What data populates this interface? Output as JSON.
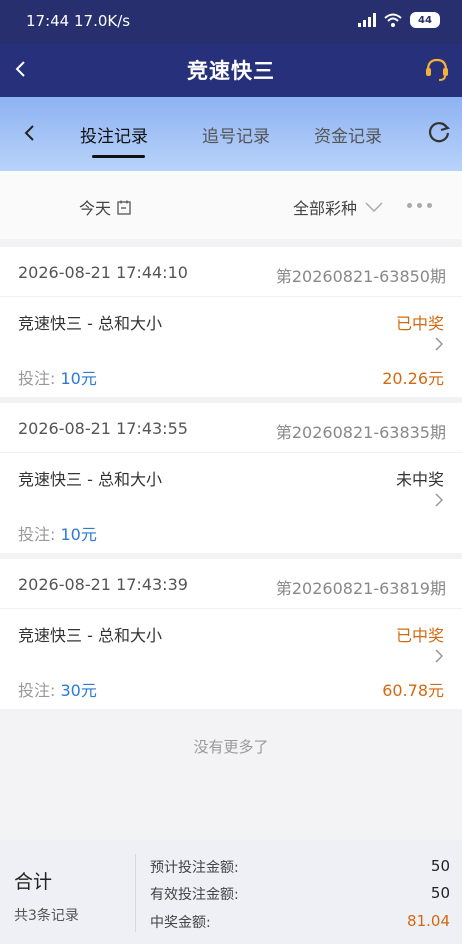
{
  "status_bar": {
    "time_speed": "17:44 17.0K/s",
    "battery": "44"
  },
  "app_bar": {
    "title": "竞速快三"
  },
  "tabs": [
    {
      "label": "投注记录",
      "active": true
    },
    {
      "label": "追号记录",
      "active": false
    },
    {
      "label": "资金记录",
      "active": false
    }
  ],
  "filters": {
    "date": "今天",
    "lottery": "全部彩种"
  },
  "records": [
    {
      "datetime": "2026-08-21 17:44:10",
      "issue": "第20260821-63850期",
      "game": "竞速快三 - 总和大小",
      "status": "已中奖",
      "bet_label": "投注:",
      "bet_amount": "10元",
      "win_amount": "20.26元"
    },
    {
      "datetime": "2026-08-21 17:43:55",
      "issue": "第20260821-63835期",
      "game": "竞速快三 - 总和大小",
      "status": "未中奖",
      "bet_label": "投注:",
      "bet_amount": "10元",
      "win_amount": ""
    },
    {
      "datetime": "2026-08-21 17:43:39",
      "issue": "第20260821-63819期",
      "game": "竞速快三 - 总和大小",
      "status": "已中奖",
      "bet_label": "投注:",
      "bet_amount": "30元",
      "win_amount": "60.78元"
    }
  ],
  "no_more": "没有更多了",
  "summary": {
    "label": "合计",
    "count": "共3条记录",
    "expected_bet_label": "预计投注金额:",
    "expected_bet_value": "50",
    "valid_bet_label": "有效投注金额:",
    "valid_bet_value": "50",
    "win_label": "中奖金额:",
    "win_value": "81.04"
  },
  "colors": {
    "header_bg": "#27307a",
    "win": "#d26a12",
    "bet_amount": "#2a7ad6"
  }
}
